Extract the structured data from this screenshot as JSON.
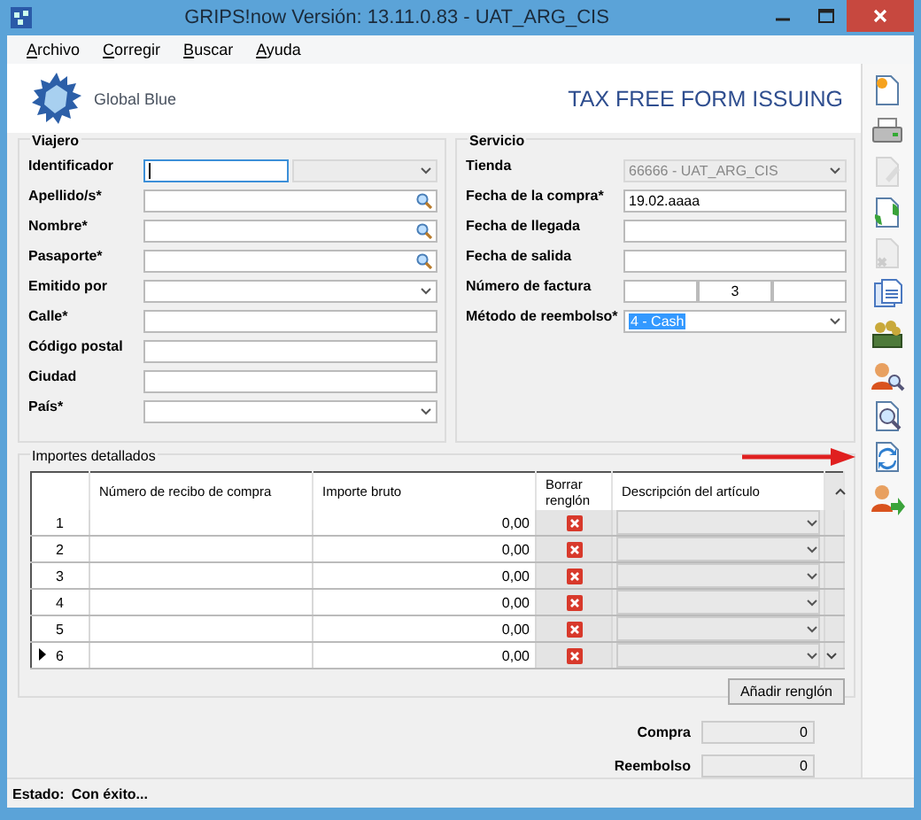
{
  "window": {
    "title": "GRIPS!now Versión: 13.11.0.83 - UAT_ARG_CIS"
  },
  "menu": [
    {
      "label": "Archivo"
    },
    {
      "label": "Corregir"
    },
    {
      "label": "Buscar"
    },
    {
      "label": "Ayuda"
    }
  ],
  "header": {
    "brand": "Global Blue",
    "title": "TAX FREE FORM ISSUING"
  },
  "traveler": {
    "title": "Viajero",
    "fields": [
      {
        "label": "Identificador",
        "kind": "id",
        "focused": true
      },
      {
        "label": "Apellido/s*",
        "kind": "search",
        "focused": false
      },
      {
        "label": "Nombre*",
        "kind": "search",
        "focused": false
      },
      {
        "label": "Pasaporte*",
        "kind": "search",
        "focused": false
      },
      {
        "label": "Emitido por",
        "kind": "select",
        "focused": false
      },
      {
        "label": "Calle*",
        "kind": "text",
        "focused": false
      },
      {
        "label": "Código postal",
        "kind": "text",
        "focused": false
      },
      {
        "label": "Ciudad",
        "kind": "text",
        "focused": false
      },
      {
        "label": "País*",
        "kind": "select",
        "focused": false
      }
    ]
  },
  "service": {
    "title": "Servicio",
    "fields": [
      {
        "label": "Tienda",
        "kind": "select",
        "value": "66666 - UAT_ARG_CIS",
        "disabled": true
      },
      {
        "label": "Fecha de la compra*",
        "kind": "text",
        "value": "19.02.aaaa",
        "disabled": false
      },
      {
        "label": "Fecha de llegada",
        "kind": "text",
        "disabled": false
      },
      {
        "label": "Fecha de salida",
        "kind": "text",
        "disabled": false
      },
      {
        "label": "Número de factura",
        "kind": "triple",
        "value": "3",
        "disabled": false
      },
      {
        "label": "Método de reembolso*",
        "kind": "select",
        "value": "4 - Cash",
        "disabled": false,
        "highlighted": true
      }
    ]
  },
  "details": {
    "title": "Importes detallados",
    "columns": [
      "Número de recibo de compra",
      "Importe bruto",
      "Borrar renglón",
      "Descripción del artículo"
    ],
    "rows": [
      {
        "number": "1",
        "amount": "0,00",
        "current": false
      },
      {
        "number": "2",
        "amount": "0,00",
        "current": false
      },
      {
        "number": "3",
        "amount": "0,00",
        "current": false
      },
      {
        "number": "4",
        "amount": "0,00",
        "current": false
      },
      {
        "number": "5",
        "amount": "0,00",
        "current": false
      },
      {
        "number": "6",
        "amount": "0,00",
        "current": true
      }
    ],
    "add_button": "Añadir renglón"
  },
  "totals": [
    {
      "label": "Compra",
      "value": "0"
    },
    {
      "label": "Reembolso",
      "value": "0"
    }
  ],
  "status": {
    "label": "Estado:",
    "value": "Con éxito..."
  },
  "toolbar": [
    {
      "disabled": false
    },
    {
      "disabled": false
    },
    {
      "disabled": true
    },
    {
      "disabled": false
    },
    {
      "disabled": true
    },
    {
      "disabled": false
    },
    {
      "disabled": false
    },
    {
      "disabled": false
    },
    {
      "disabled": false
    },
    {
      "disabled": false
    },
    {
      "disabled": false
    }
  ]
}
